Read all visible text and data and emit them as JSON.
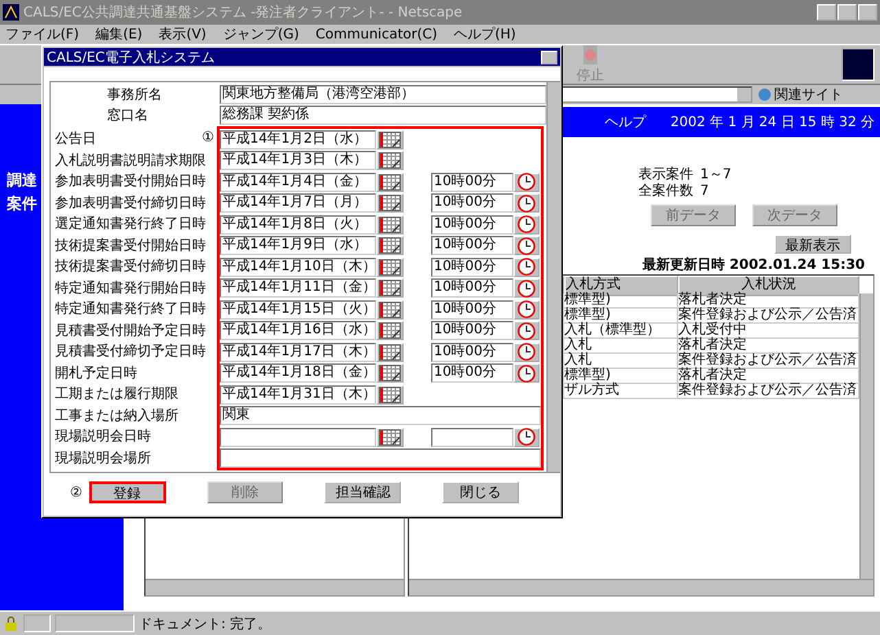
{
  "browser": {
    "title": "CALS/EC公共調達共通基盤システム -発注者クライアント- - Netscape",
    "menu": [
      "ファイル(F)",
      "編集(E)",
      "表示(V)",
      "ジャンプ(G)",
      "Communicator(C)",
      "ヘルプ(H)"
    ],
    "stop_label": "停止",
    "related_sites": "関連サイト",
    "status": "ドキュメント: 完了。"
  },
  "page": {
    "sidebar_text": [
      "調達",
      "案件"
    ],
    "help": "ヘルプ",
    "datetime": "2002 年 1 月 24 日 15 時 32 分",
    "counts": [
      {
        "label": "表示案件",
        "value": "1～7"
      },
      {
        "label": "全案件数",
        "value": "7"
      }
    ],
    "nav_buttons": [
      {
        "label": "前データ",
        "disabled": true
      },
      {
        "label": "次データ",
        "disabled": true
      }
    ],
    "refresh_button": "最新表示",
    "updated": "最新更新日時 2002.01.24 15:30",
    "table": {
      "columns": [
        "入札方式",
        "入札状況"
      ],
      "rows": [
        [
          "標準型)",
          "落札者決定"
        ],
        [
          "標準型)",
          "案件登録および公示／公告済"
        ],
        [
          "入札（標準型）",
          "入札受付中"
        ],
        [
          "入札",
          "落札者決定"
        ],
        [
          "入札",
          "案件登録および公示／公告済"
        ],
        [
          "標準型)",
          "落札者決定"
        ],
        [
          "ザル方式",
          "案件登録および公示／公告済"
        ]
      ]
    }
  },
  "dialog": {
    "title": "CALS/EC電子入札システム",
    "header_fields": [
      {
        "label": "事務所名",
        "value": "関東地方整備局（港湾空港部）"
      },
      {
        "label": "窓口名",
        "value": "総務課 契約係"
      }
    ],
    "form_marker": "①",
    "form_highlighted": true,
    "rows": [
      {
        "label": "公告日",
        "kind": "date",
        "date": "平成14年1月2日（水）"
      },
      {
        "label": "入札説明書説明請求期限",
        "kind": "date",
        "date": "平成14年1月3日（木）"
      },
      {
        "label": "参加表明書受付開始日時",
        "kind": "datetime",
        "date": "平成14年1月4日（金）",
        "time": "10時00分"
      },
      {
        "label": "参加表明書受付締切日時",
        "kind": "datetime",
        "date": "平成14年1月7日（月）",
        "time": "10時00分"
      },
      {
        "label": "選定通知書発行終了日時",
        "kind": "datetime",
        "date": "平成14年1月8日（火）",
        "time": "10時00分"
      },
      {
        "label": "技術提案書受付開始日時",
        "kind": "datetime",
        "date": "平成14年1月9日（水）",
        "time": "10時00分"
      },
      {
        "label": "技術提案書受付締切日時",
        "kind": "datetime",
        "date": "平成14年1月10日（木）",
        "time": "10時00分"
      },
      {
        "label": "特定通知書発行開始日時",
        "kind": "datetime",
        "date": "平成14年1月11日（金）",
        "time": "10時00分"
      },
      {
        "label": "特定通知書発行終了日時",
        "kind": "datetime",
        "date": "平成14年1月15日（火）",
        "time": "10時00分"
      },
      {
        "label": "見積書受付開始予定日時",
        "kind": "datetime",
        "date": "平成14年1月16日（水）",
        "time": "10時00分"
      },
      {
        "label": "見積書受付締切予定日時",
        "kind": "datetime",
        "date": "平成14年1月17日（木）",
        "time": "10時00分"
      },
      {
        "label": "開札予定日時",
        "kind": "datetime",
        "date": "平成14年1月18日（金）",
        "time": "10時00分"
      },
      {
        "label": "工期または履行期限",
        "kind": "date",
        "date": "平成14年1月31日（木）"
      },
      {
        "label": "工事または納入場所",
        "kind": "text",
        "value": "関東"
      },
      {
        "label": "現場説明会日時",
        "kind": "datetime"
      },
      {
        "label": "現場説明会場所",
        "kind": "text"
      }
    ],
    "button_marker": "②",
    "buttons": [
      {
        "label": "登録",
        "disabled": false,
        "highlighted": true
      },
      {
        "label": "削除",
        "disabled": true,
        "highlighted": false
      },
      {
        "label": "担当確認",
        "disabled": false,
        "highlighted": false
      },
      {
        "label": "閉じる",
        "disabled": false,
        "highlighted": false
      }
    ]
  }
}
